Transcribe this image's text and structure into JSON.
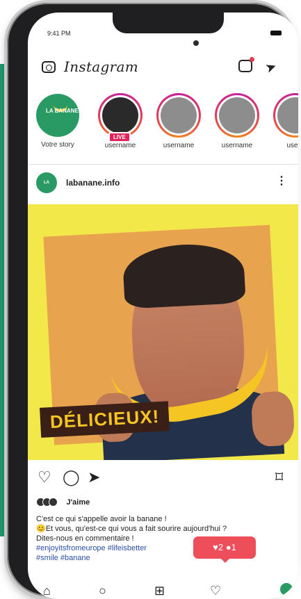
{
  "status": {
    "time": "9:41 PM"
  },
  "app": {
    "title": "Instagram"
  },
  "stories": [
    {
      "name": "Votre story",
      "type": "own",
      "logo": "LA BANANE"
    },
    {
      "name": "username",
      "live": "LIVE"
    },
    {
      "name": "username"
    },
    {
      "name": "username"
    },
    {
      "name": "usern"
    }
  ],
  "post": {
    "username": "labanane.info",
    "avatar_logo": "LA BANANE",
    "image_text": "DÉLICIEUX!",
    "likes": "J'aime",
    "caption_lines": [
      "C'est ce qui s'appelle avoir la banane !",
      "😊Et vous, qu'est-ce qui vous a fait sourire aujourd'hui ?",
      "Dites-nous en commentaire !"
    ],
    "tags_lines": [
      "#enjoyitsfromeurope #lifeisbetter",
      "#smile #banane"
    ]
  },
  "notification": {
    "text": "♥2 ●1"
  },
  "colors": {
    "green": "#1f9a6e",
    "yellow": "#f2e84a",
    "notif": "#ee4d5a"
  },
  "icons": {
    "header": [
      "camera-icon",
      "igtv-icon",
      "direct-message-icon"
    ],
    "post": [
      "heart-icon",
      "comment-icon",
      "share-icon",
      "bookmark-icon"
    ],
    "nav": [
      "home-icon",
      "search-icon",
      "add-post-icon",
      "activity-icon",
      "profile-icon"
    ]
  }
}
